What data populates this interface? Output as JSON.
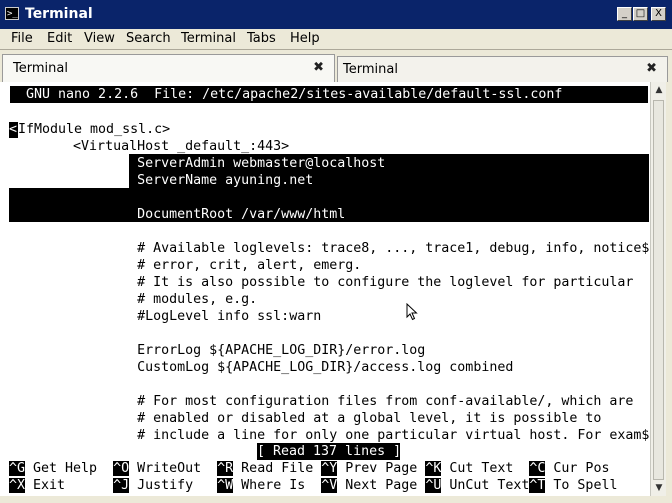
{
  "window": {
    "title": "Terminal",
    "buttons": [
      "_",
      "□",
      "X"
    ]
  },
  "menubar": {
    "items": [
      "File",
      "Edit",
      "View",
      "Search",
      "Terminal",
      "Tabs",
      "Help"
    ]
  },
  "tabs": [
    {
      "label": "Terminal",
      "close": "✖"
    },
    {
      "label": "Terminal",
      "close": "✖"
    }
  ],
  "nano": {
    "header": "  GNU nano 2.2.6  File: /etc/apache2/sites-available/default-ssl.conf",
    "lines": [
      "",
      "IfModule mod_ssl.c>",
      "        <VirtualHost _default_:443>",
      "                ServerAdmin webmaster@localhost",
      "                ServerName ayuning.net",
      "",
      "                DocumentRoot /var/www/html",
      "",
      "                # Available loglevels: trace8, ..., trace1, debug, info, notice$",
      "                # error, crit, alert, emerg.",
      "                # It is also possible to configure the loglevel for particular",
      "                # modules, e.g.",
      "                #LogLevel info ssl:warn",
      "",
      "                ErrorLog ${APACHE_LOG_DIR}/error.log",
      "                CustomLog ${APACHE_LOG_DIR}/access.log combined",
      "",
      "                # For most configuration files from conf-available/, which are",
      "                # enabled or disabled at a global level, it is possible to",
      "                # include a line for only one particular virtual host. For exam$"
    ],
    "cursor_char": "<",
    "status": "[ Read 137 lines ]",
    "shortcuts_row1": [
      {
        "key": "^G",
        "label": " Get Help  "
      },
      {
        "key": "^O",
        "label": " WriteOut  "
      },
      {
        "key": "^R",
        "label": " Read File "
      },
      {
        "key": "^Y",
        "label": " Prev Page "
      },
      {
        "key": "^K",
        "label": " Cut Text  "
      },
      {
        "key": "^C",
        "label": " Cur Pos"
      }
    ],
    "shortcuts_row2": [
      {
        "key": "^X",
        "label": " Exit      "
      },
      {
        "key": "^J",
        "label": " Justify   "
      },
      {
        "key": "^W",
        "label": " Where Is  "
      },
      {
        "key": "^V",
        "label": " Next Page "
      },
      {
        "key": "^U",
        "label": " UnCut Text"
      },
      {
        "key": "^T",
        "label": " To Spell"
      }
    ]
  }
}
